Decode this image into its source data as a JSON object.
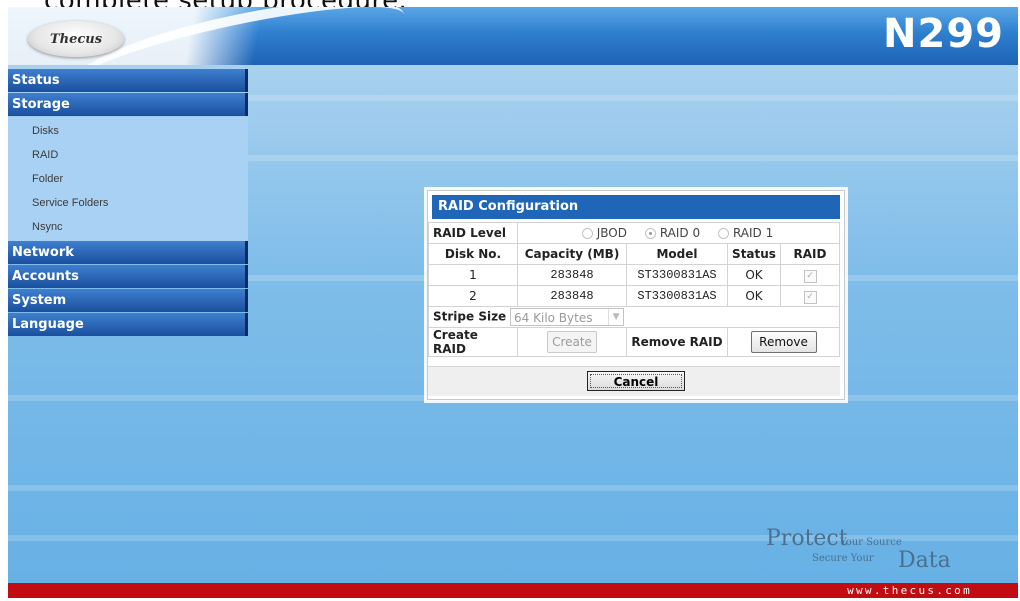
{
  "caption": "complete setup procedure.",
  "header": {
    "logo_text": "Thecus",
    "model": "N299"
  },
  "sidebar": {
    "sections": [
      {
        "label": "Status",
        "items": []
      },
      {
        "label": "Storage",
        "items": [
          "Disks",
          "RAID",
          "Folder",
          "Service Folders",
          "Nsync"
        ]
      },
      {
        "label": "Network",
        "items": []
      },
      {
        "label": "Accounts",
        "items": []
      },
      {
        "label": "System",
        "items": []
      },
      {
        "label": "Language",
        "items": []
      }
    ]
  },
  "dialog": {
    "title": "RAID Configuration",
    "raid_level_label": "RAID Level",
    "raid_options": [
      {
        "label": "JBOD",
        "selected": false
      },
      {
        "label": "RAID 0",
        "selected": true
      },
      {
        "label": "RAID 1",
        "selected": false
      }
    ],
    "columns": [
      "Disk No.",
      "Capacity (MB)",
      "Model",
      "Status",
      "RAID"
    ],
    "rows": [
      {
        "disk": "1",
        "capacity": "283848",
        "model": "ST3300831AS",
        "status": "OK",
        "raid": true
      },
      {
        "disk": "2",
        "capacity": "283848",
        "model": "ST3300831AS",
        "status": "OK",
        "raid": true
      }
    ],
    "stripe_size_label": "Stripe Size",
    "stripe_size_value": "64 Kilo Bytes",
    "create_raid_label": "Create RAID",
    "create_button": "Create",
    "remove_raid_label": "Remove RAID",
    "remove_button": "Remove",
    "cancel_button": "Cancel"
  },
  "slogan": {
    "word1": "Protect",
    "phrase1": "Your Source",
    "phrase2": "Secure Your",
    "word2": "Data"
  },
  "footer": {
    "url": "www.thecus.com"
  },
  "colors": {
    "menu_header": "#1a4f9e",
    "dialog_title": "#1f66b8",
    "footer": "#c10d12"
  }
}
